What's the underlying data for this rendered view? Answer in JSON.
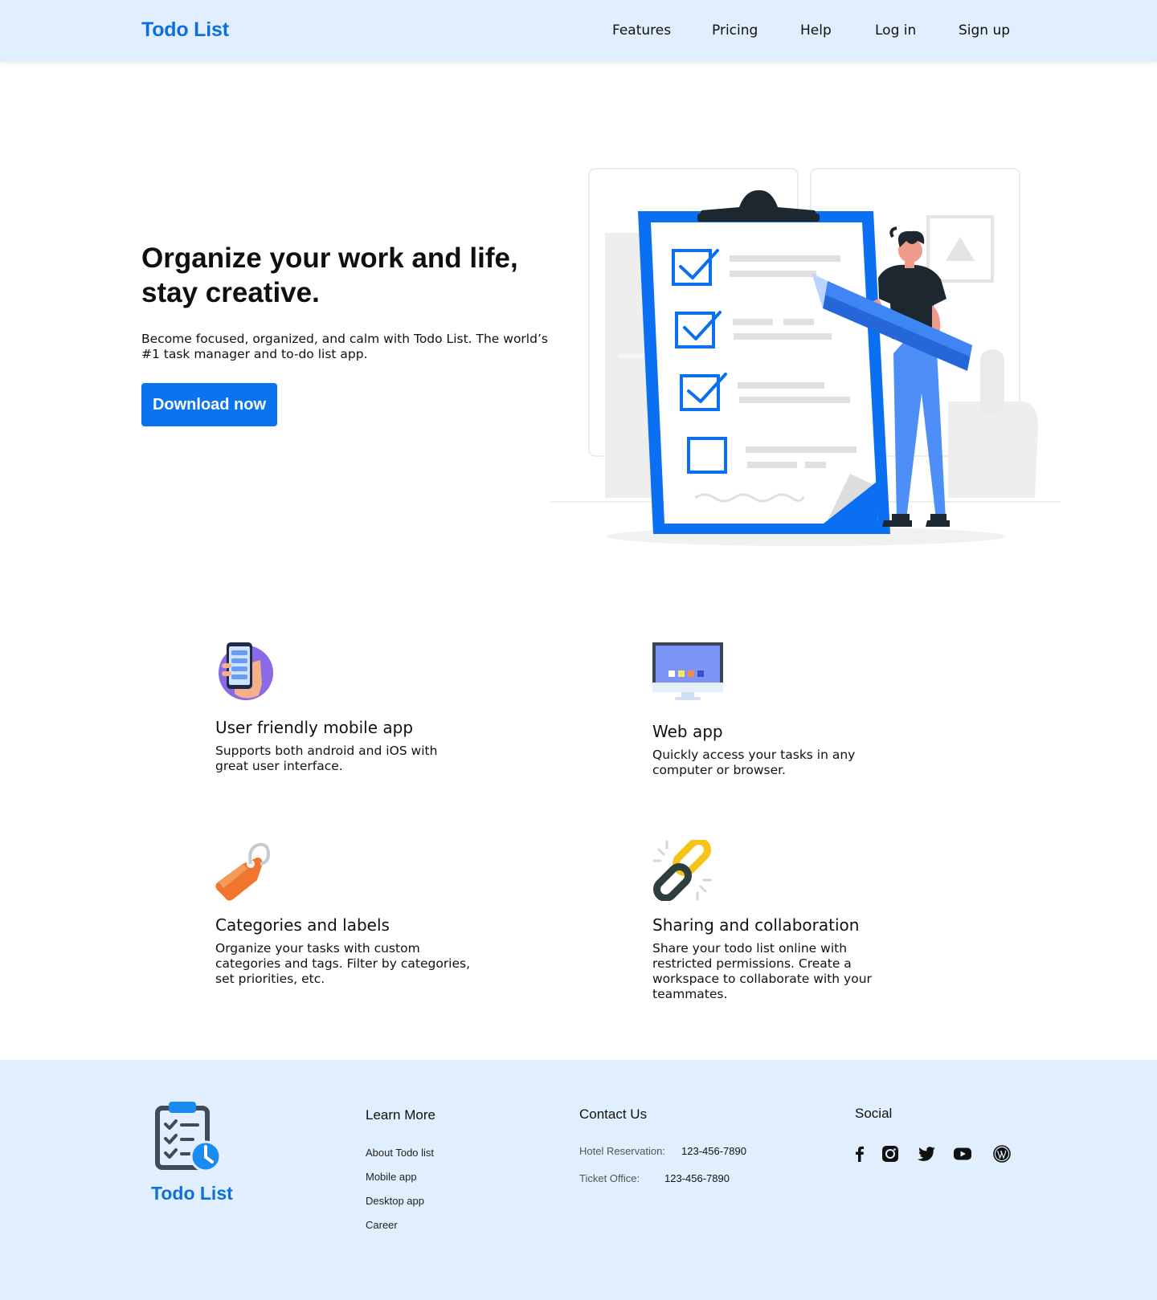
{
  "header": {
    "brand": "Todo List",
    "nav": [
      {
        "label": "Features"
      },
      {
        "label": "Pricing"
      },
      {
        "label": "Help"
      },
      {
        "label": "Log in"
      },
      {
        "label": "Sign up"
      }
    ]
  },
  "hero": {
    "title_line1": "Organize your work and life,",
    "title_line2": "stay creative.",
    "subtitle": "Become focused, organized, and calm with Todo List. The world’s #1 task manager and to-do list app.",
    "cta": "Download now",
    "illustration": "clipboard-checklist-person-illustration"
  },
  "features": [
    {
      "icon": "mobile-app-icon",
      "title": "User friendly mobile app",
      "desc": "Supports both android and iOS with great user interface."
    },
    {
      "icon": "monitor-icon",
      "title": "Web app",
      "desc": "Quickly access your tasks in any computer or browser."
    },
    {
      "icon": "tag-icon",
      "title": "Categories and labels",
      "desc": "Organize your tasks with custom categories and tags. Filter by categories, set priorities, etc."
    },
    {
      "icon": "link-icon",
      "title": "Sharing and collaboration",
      "desc": "Share your todo list online with restricted permissions. Create a workspace to collaborate with your teammates."
    }
  ],
  "footer": {
    "brand": "Todo List",
    "learn_more": {
      "heading": "Learn More",
      "links": [
        "About Todo list",
        "Mobile app",
        "Desktop app",
        "Career"
      ]
    },
    "contact": {
      "heading": "Contact Us",
      "items": [
        {
          "label": "Hotel Reservation:",
          "value": "123-456-7890"
        },
        {
          "label": "Ticket Office:",
          "value": "123-456-7890"
        }
      ]
    },
    "social": {
      "heading": "Social",
      "icons": [
        "facebook-icon",
        "instagram-icon",
        "twitter-icon",
        "youtube-icon",
        "wordpress-icon"
      ]
    }
  },
  "colors": {
    "brand": "#0d6fde",
    "primary_button": "#0a74f0",
    "header_bg": "#e1eefd",
    "footer_bg": "#e1eefd"
  }
}
